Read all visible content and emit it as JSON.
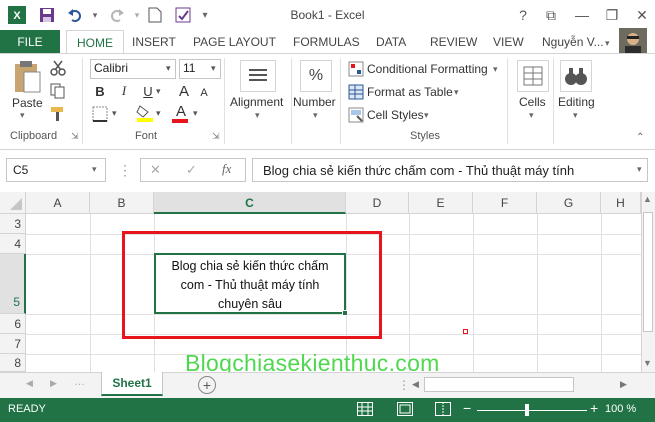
{
  "window": {
    "title": "Book1 - Excel",
    "help": "?",
    "minimize": "—",
    "restore": "❐",
    "close": "✕",
    "ribbon_display": "⧉"
  },
  "tabs": [
    "FILE",
    "HOME",
    "INSERT",
    "PAGE LAYOUT",
    "FORMULAS",
    "DATA",
    "REVIEW",
    "VIEW"
  ],
  "user": "Nguyễn V...",
  "ribbon": {
    "clipboard": {
      "paste": "Paste",
      "label": "Clipboard"
    },
    "font": {
      "name": "Calibri",
      "size": "11",
      "bold": "B",
      "italic": "I",
      "underline": "U",
      "label": "Font",
      "font_color": "A",
      "grow": "A",
      "shrink": "A"
    },
    "alignment": {
      "label": "Alignment"
    },
    "number": {
      "label": "Number",
      "symbol": "%"
    },
    "styles": {
      "conditional": "Conditional Formatting",
      "format_table": "Format as Table",
      "cell_styles": "Cell Styles",
      "label": "Styles"
    },
    "cells": {
      "label": "Cells"
    },
    "editing": {
      "label": "Editing"
    }
  },
  "formula_bar": {
    "name_box": "C5",
    "cancel": "✕",
    "enter": "✓",
    "fx": "fx",
    "content": "Blog chia sẻ kiến thức chấm com - Thủ thuật máy tính"
  },
  "columns": [
    "A",
    "B",
    "C",
    "D",
    "E",
    "F",
    "G",
    "H"
  ],
  "rows": [
    "3",
    "4",
    "5",
    "6",
    "7",
    "8"
  ],
  "cell_c5": {
    "line1": "Blog chia sẻ kiến thức chấm",
    "line2": "com - Thủ thuật máy tính",
    "line3": "chuyên sâu"
  },
  "watermark": "Blogchiasekienthuc.com",
  "sheet": {
    "name": "Sheet1",
    "add": "+"
  },
  "status": {
    "ready": "READY",
    "zoom": "100 %",
    "minus": "−",
    "plus": "+"
  },
  "colors": {
    "accent": "#217346",
    "highlight_box": "#e8141b"
  }
}
